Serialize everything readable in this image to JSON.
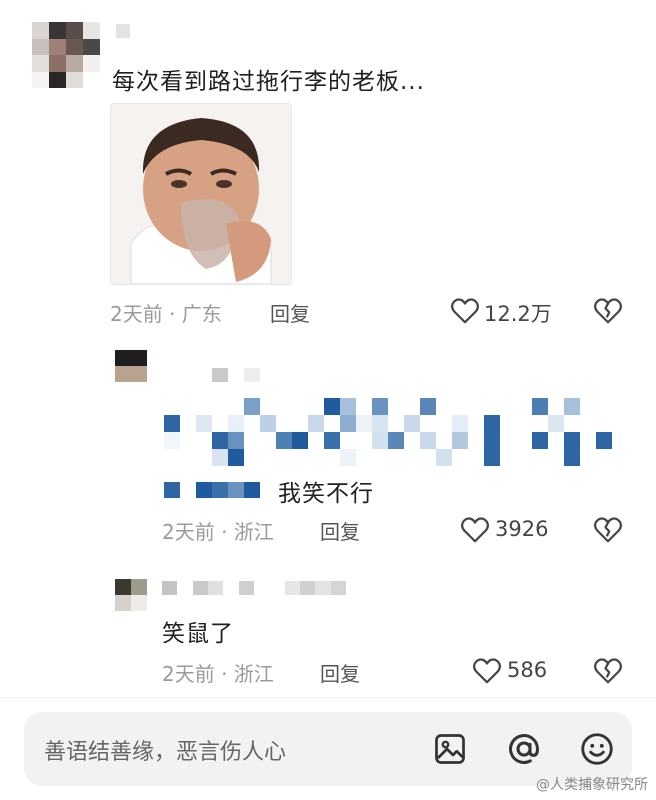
{
  "comments": [
    {
      "text": "每次看到路过拖行李的老板...",
      "time": "2天前",
      "separator": "·",
      "location": "广东",
      "reply_label": "回复",
      "like_count": "12.2万"
    },
    {
      "text": "我笑不行",
      "time": "2天前",
      "separator": "·",
      "location": "浙江",
      "reply_label": "回复",
      "like_count": "3926"
    },
    {
      "text": "笑鼠了",
      "time": "2天前",
      "separator": "·",
      "location": "浙江",
      "reply_label": "回复",
      "like_count": "586"
    }
  ],
  "input": {
    "placeholder": "善语结善缘，恶言伤人心"
  },
  "icons": {
    "like": "heart-outline-icon",
    "dislike": "broken-heart-icon",
    "image": "image-icon",
    "mention": "at-sign-icon",
    "emoji": "smiley-icon"
  },
  "watermark": "@人类捕象研究所",
  "colors": {
    "accent_blue": "#1f5c9e",
    "meta_gray": "#9a9a9a"
  }
}
